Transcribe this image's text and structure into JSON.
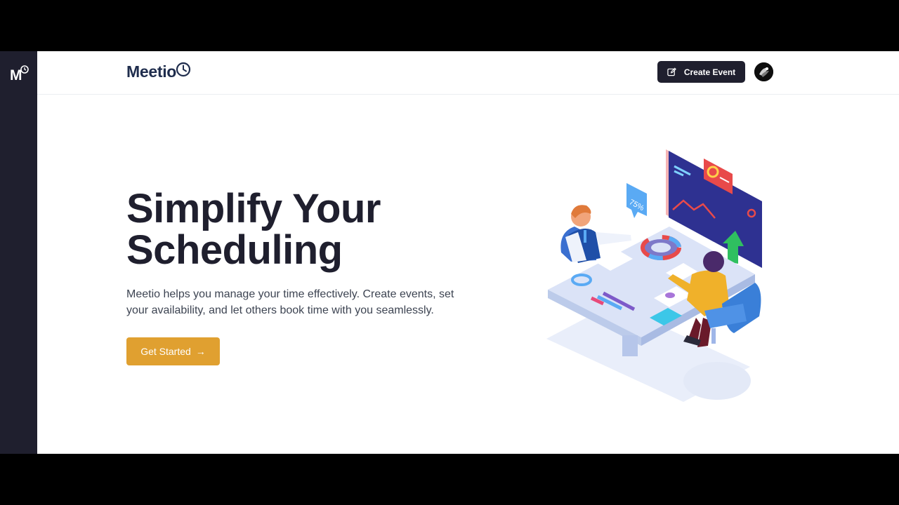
{
  "sidebar": {
    "logo_letter": "M"
  },
  "header": {
    "brand": "Meetio",
    "create_event_label": "Create Event",
    "create_event_icon": "edit-icon",
    "avatar_icon": "avatar-image"
  },
  "hero": {
    "title_line1": "Simplify Your",
    "title_line2": "Scheduling",
    "description_line1": "Meetio helps you manage your time effectively. Create events, set",
    "description_line2": "your availability, and let others book time with you seamlessly.",
    "cta_label": "Get Started",
    "cta_arrow": "→",
    "illustration_badge": "75%"
  },
  "colors": {
    "sidebar_bg": "#1f1f2e",
    "brand_text": "#1f2d4d",
    "primary_dark": "#1f1f2e",
    "accent": "#e0a030"
  }
}
